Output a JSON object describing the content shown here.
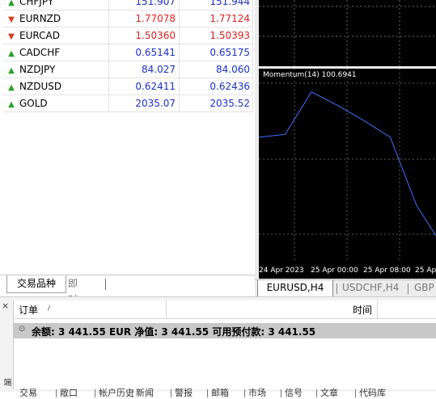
{
  "market_watch": {
    "rows": [
      {
        "symbol": "CHFJPY",
        "direction": "up",
        "bid": "151.907",
        "ask": "151.944",
        "color": "blue"
      },
      {
        "symbol": "EURNZD",
        "direction": "down",
        "bid": "1.77078",
        "ask": "1.77124",
        "color": "red"
      },
      {
        "symbol": "EURCAD",
        "direction": "down",
        "bid": "1.50360",
        "ask": "1.50393",
        "color": "red"
      },
      {
        "symbol": "CADCHF",
        "direction": "up",
        "bid": "0.65141",
        "ask": "0.65175",
        "color": "blue"
      },
      {
        "symbol": "NZDJPY",
        "direction": "up",
        "bid": "84.027",
        "ask": "84.060",
        "color": "blue"
      },
      {
        "symbol": "NZDUSD",
        "direction": "up",
        "bid": "0.62411",
        "ask": "0.62436",
        "color": "blue"
      },
      {
        "symbol": "GOLD",
        "direction": "up",
        "bid": "2035.07",
        "ask": "2035.52",
        "color": "blue"
      }
    ],
    "tabs": {
      "symbols": "交易品种",
      "tick_chart": "即时图"
    }
  },
  "chart": {
    "indicator_label": "Momentum(14) 100.6941",
    "x_ticks": [
      "24 Apr 2023",
      "25 Apr 00:00",
      "25 Apr 08:00",
      "25 Apr"
    ],
    "tabs": {
      "eurusd": "EURUSD,H4",
      "usdchf": "USDCHF,H4",
      "gbp": "GBP"
    }
  },
  "chart_data": {
    "type": "line",
    "title": "Momentum(14) 100.6941",
    "series": [
      {
        "values": [
          100.2,
          100.24,
          100.8,
          100.62,
          100.42,
          100.2,
          99.3,
          98.9
        ]
      }
    ]
  },
  "terminal": {
    "close_glyph": "×",
    "side_label": "端",
    "header": {
      "order": "订单",
      "sort": "/",
      "time": "时间"
    },
    "balance_line": "余额: 3 441.55 EUR  净值: 3 441.55  可用预付款: 3 441.55",
    "tabs": [
      "交易",
      "敞口",
      "帐户历史",
      "新闻",
      "警报",
      "邮箱",
      "市场",
      "信号",
      "文章",
      "代码库"
    ]
  },
  "colors": {
    "up": "#2aa12a",
    "down": "#d83a1a",
    "blue": "#1c2fc8",
    "red": "#e02020",
    "chart_line": "#3f6fff"
  }
}
